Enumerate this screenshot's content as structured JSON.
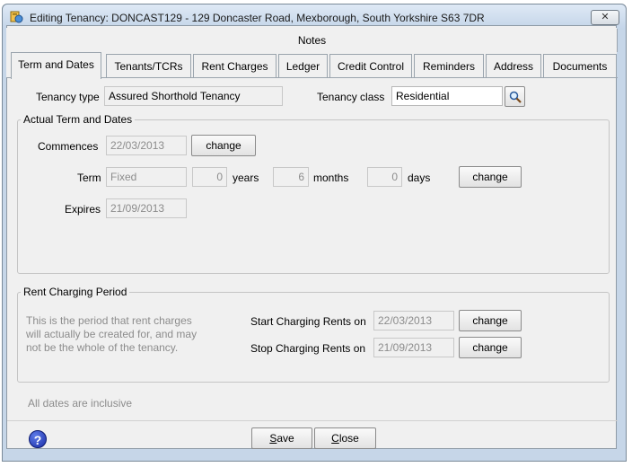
{
  "window": {
    "title": "Editing Tenancy: DONCAST129 - 129 Doncaster Road, Mexborough, South Yorkshire S63 7DR",
    "close_glyph": "✕"
  },
  "tabs": {
    "notes": "Notes",
    "items": [
      "Term and Dates",
      "Tenants/TCRs",
      "Rent Charges",
      "Ledger",
      "Credit Control",
      "Reminders",
      "Address",
      "Documents"
    ],
    "active": "Term and Dates"
  },
  "tenancy": {
    "type_label": "Tenancy type",
    "type_value": "Assured Shorthold Tenancy",
    "class_label": "Tenancy class",
    "class_value": "Residential"
  },
  "actual_term": {
    "group_title": "Actual Term and Dates",
    "commences_label": "Commences",
    "commences_value": "22/03/2013",
    "term_label": "Term",
    "term_value": "Fixed",
    "years_value": "0",
    "years_label": "years",
    "months_value": "6",
    "months_label": "months",
    "days_value": "0",
    "days_label": "days",
    "expires_label": "Expires",
    "expires_value": "21/09/2013",
    "change_label": "change"
  },
  "rent_period": {
    "group_title": "Rent Charging Period",
    "hint_line1": "This is the period that rent charges",
    "hint_line2": "will actually be created for, and may",
    "hint_line3": "not be the whole of the tenancy.",
    "start_label": "Start Charging Rents on",
    "start_value": "22/03/2013",
    "stop_label": "Stop Charging Rents on",
    "stop_value": "21/09/2013",
    "change_label": "change"
  },
  "footer": {
    "inclusive_note": "All dates are inclusive",
    "help_glyph": "?",
    "save_first": "S",
    "save_rest": "ave",
    "close_first": "C",
    "close_rest": "lose"
  },
  "colors": {
    "window_frame": "#c6d6e8",
    "client_bg": "#f0f0f0",
    "disabled_text": "#8c8c8c"
  }
}
